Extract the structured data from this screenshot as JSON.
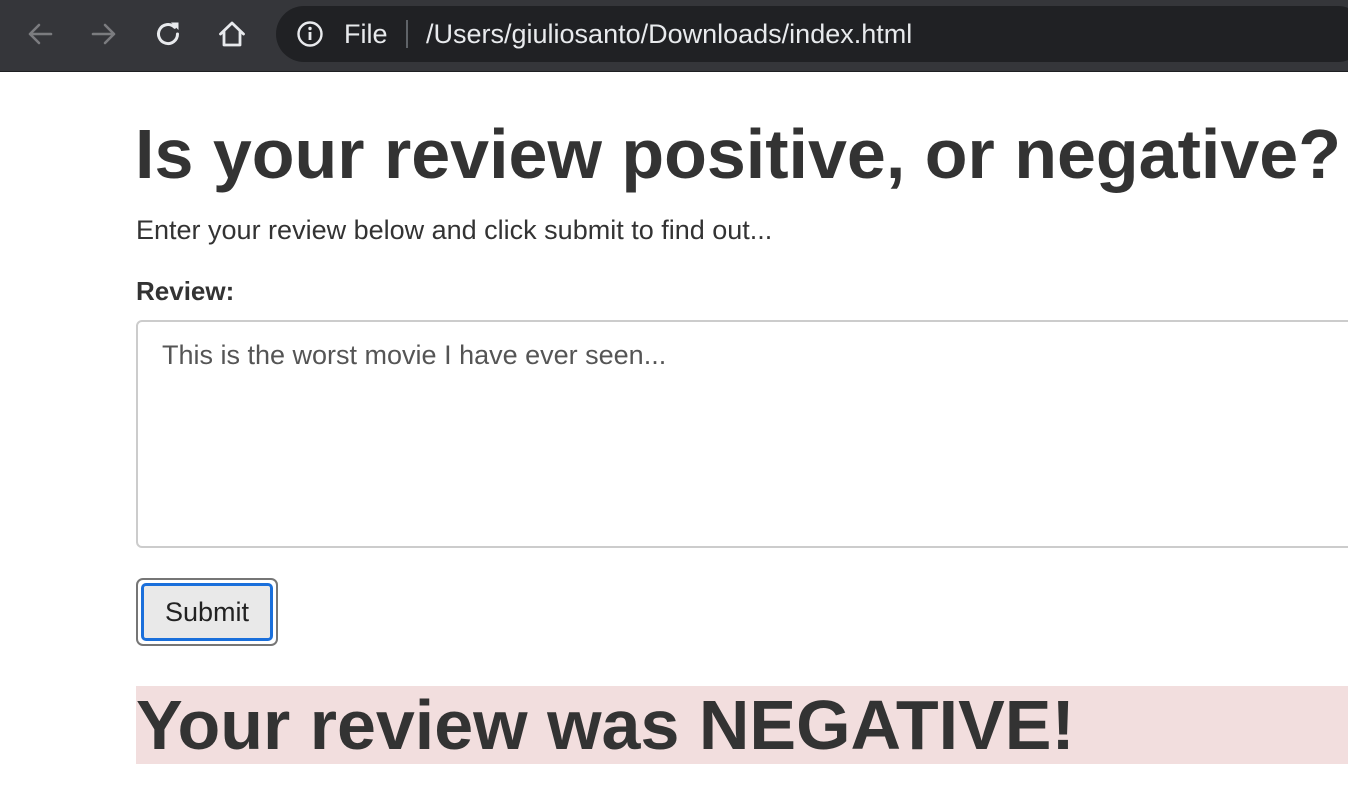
{
  "browser": {
    "scheme_label": "File",
    "url": "/Users/giuliosanto/Downloads/index.html",
    "icons": {
      "back": "arrow-left-icon",
      "forward": "arrow-right-icon",
      "reload": "reload-icon",
      "home": "home-icon",
      "info": "info-icon"
    },
    "colors": {
      "toolbar": "#35363a",
      "omnibox": "#202124",
      "text": "#e8eaed"
    }
  },
  "page": {
    "title": "Is your review positive, or negative?",
    "subtitle": "Enter your review below and click submit to find out...",
    "review_label": "Review:",
    "review_value": "This is the worst movie I have ever seen...",
    "submit_label": "Submit",
    "result": "Your review was NEGATIVE!",
    "colors": {
      "result_background": "#f2dede",
      "focus_ring": "#1a6fdb"
    }
  }
}
